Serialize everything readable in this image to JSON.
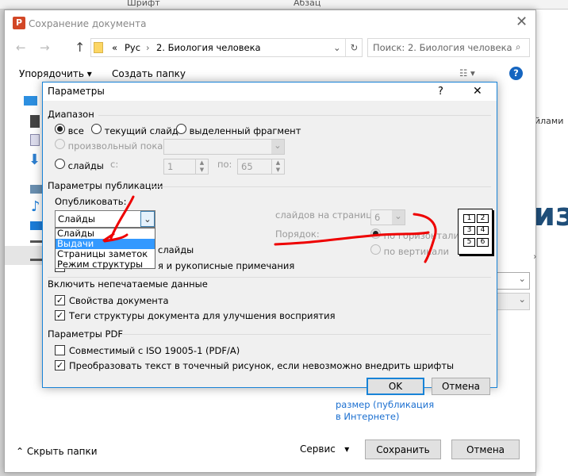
{
  "ribbon": {
    "font": "Шрифт",
    "paragraph": "Абзац"
  },
  "background": {
    "right_text": "йлами",
    "big_text": "из",
    "link_line1": "размер (публикация",
    "link_line2": "в Интернете)"
  },
  "save_dialog": {
    "title": "Сохранение документа",
    "breadcrumb": {
      "prefix": "«",
      "items": [
        "Рус",
        "2. Биология человека"
      ]
    },
    "search_placeholder": "Поиск: 2. Биология человека",
    "toolbar": {
      "organize": "Упорядочить",
      "new_folder": "Создать папку",
      "help": "?"
    },
    "hide_folders": "Скрыть папки",
    "service": "Сервис",
    "save": "Сохранить",
    "cancel": "Отмена"
  },
  "params": {
    "title": "Параметры",
    "help": "?",
    "range": {
      "label": "Диапазон",
      "all": "все",
      "current": "текущий слайд",
      "selection": "выделенный фрагмент",
      "custom": "произвольный показ:",
      "slides": "слайды",
      "from_label": "с:",
      "from": "1",
      "to_label": "по:",
      "to": "65",
      "selected": "all"
    },
    "publish": {
      "label": "Параметры публикации",
      "what_label": "Опубликовать:",
      "value": "Слайды",
      "options": [
        "Слайды",
        "Выдачи",
        "Страницы заметок",
        "Режим структуры"
      ],
      "highlighted": "Выдачи",
      "per_page_label": "слайдов на странице:",
      "per_page": "6",
      "order_label": "Порядок:",
      "horizontal": "по горизонтали",
      "vertical": "по вертикали",
      "hidden1": "слайды",
      "hidden2": "я и рукописные примечания",
      "preview": [
        "1",
        "2",
        "3",
        "4",
        "5",
        "6"
      ]
    },
    "nonprint": {
      "label": "Включить непечатаемые данные",
      "doc_props": "Свойства документа",
      "struct_tags": "Теги структуры документа для улучшения восприятия"
    },
    "pdf": {
      "label": "Параметры PDF",
      "iso": "Совместимый с ISO 19005-1 (PDF/A)",
      "bitmap": "Преобразовать текст в точечный рисунок, если невозможно внедрить шрифты"
    },
    "ok": "OK",
    "cancel": "Отмена"
  },
  "colors": {
    "accent": "#1883d7",
    "annotation": "#e00000",
    "selection": "#3399ff"
  }
}
